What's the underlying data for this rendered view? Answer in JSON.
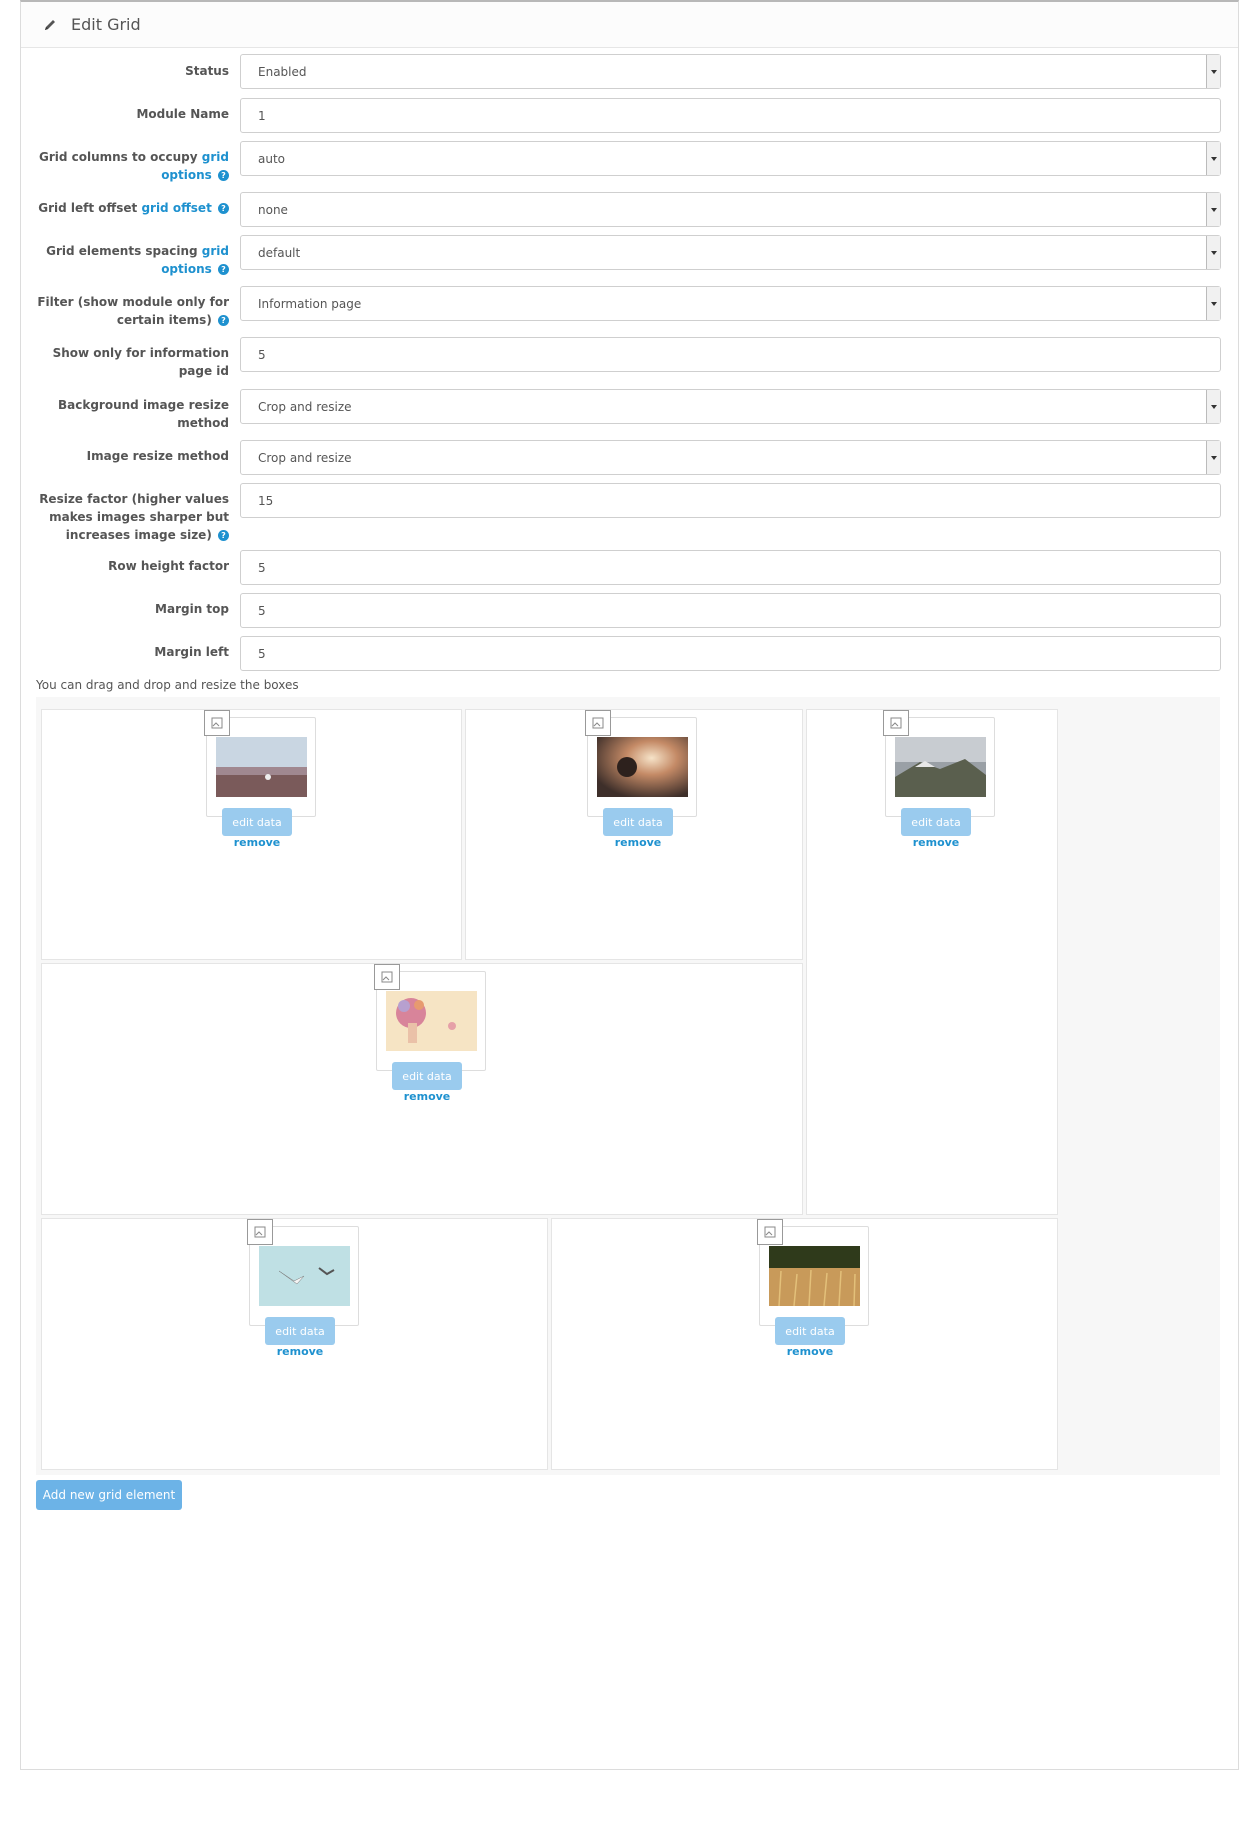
{
  "header": {
    "title": "Edit Grid"
  },
  "form": {
    "status": {
      "label": "Status",
      "value": "Enabled"
    },
    "module_name": {
      "label": "Module Name",
      "value": "1"
    },
    "grid_columns": {
      "label": "Grid columns to occupy",
      "link1": "grid",
      "link2": "options",
      "value": "auto"
    },
    "grid_offset": {
      "label": "Grid left offset",
      "link": "grid offset",
      "value": "none"
    },
    "grid_spacing": {
      "label": "Grid elements spacing",
      "link1": "grid",
      "link2": "options",
      "value": "default"
    },
    "filter": {
      "label_line1": "Filter (show module only for",
      "label_line2": "certain items)",
      "value": "Information page"
    },
    "info_page_id": {
      "label_line1": "Show only for information",
      "label_line2": "page id",
      "value": "5"
    },
    "bg_resize": {
      "label_line1": "Background image resize",
      "label_line2": "method",
      "value": "Crop and resize"
    },
    "img_resize": {
      "label": "Image resize method",
      "value": "Crop and resize"
    },
    "resize_factor": {
      "label_line1": "Resize factor (higher values",
      "label_line2": "makes images sharper but",
      "label_line3": "increases image size)",
      "value": "15"
    },
    "row_height": {
      "label": "Row height factor",
      "value": "5"
    },
    "margin_top": {
      "label": "Margin top",
      "value": "5"
    },
    "margin_left": {
      "label": "Margin left",
      "value": "5"
    }
  },
  "grid": {
    "hint": "You can drag and drop and resize the boxes",
    "edit_label": "edit data",
    "remove_label": "remove",
    "elements": [
      {
        "image": "desert-landscape"
      },
      {
        "image": "sunset-couple"
      },
      {
        "image": "mountain-clouds"
      },
      {
        "image": "woman-flowers"
      },
      {
        "image": "birds-sky"
      },
      {
        "image": "wheat-field"
      }
    ]
  },
  "add_button": "Add new grid element",
  "colors": {
    "accent": "#1e91cf",
    "button": "#9acbee",
    "add_button": "#6cb3e7"
  }
}
